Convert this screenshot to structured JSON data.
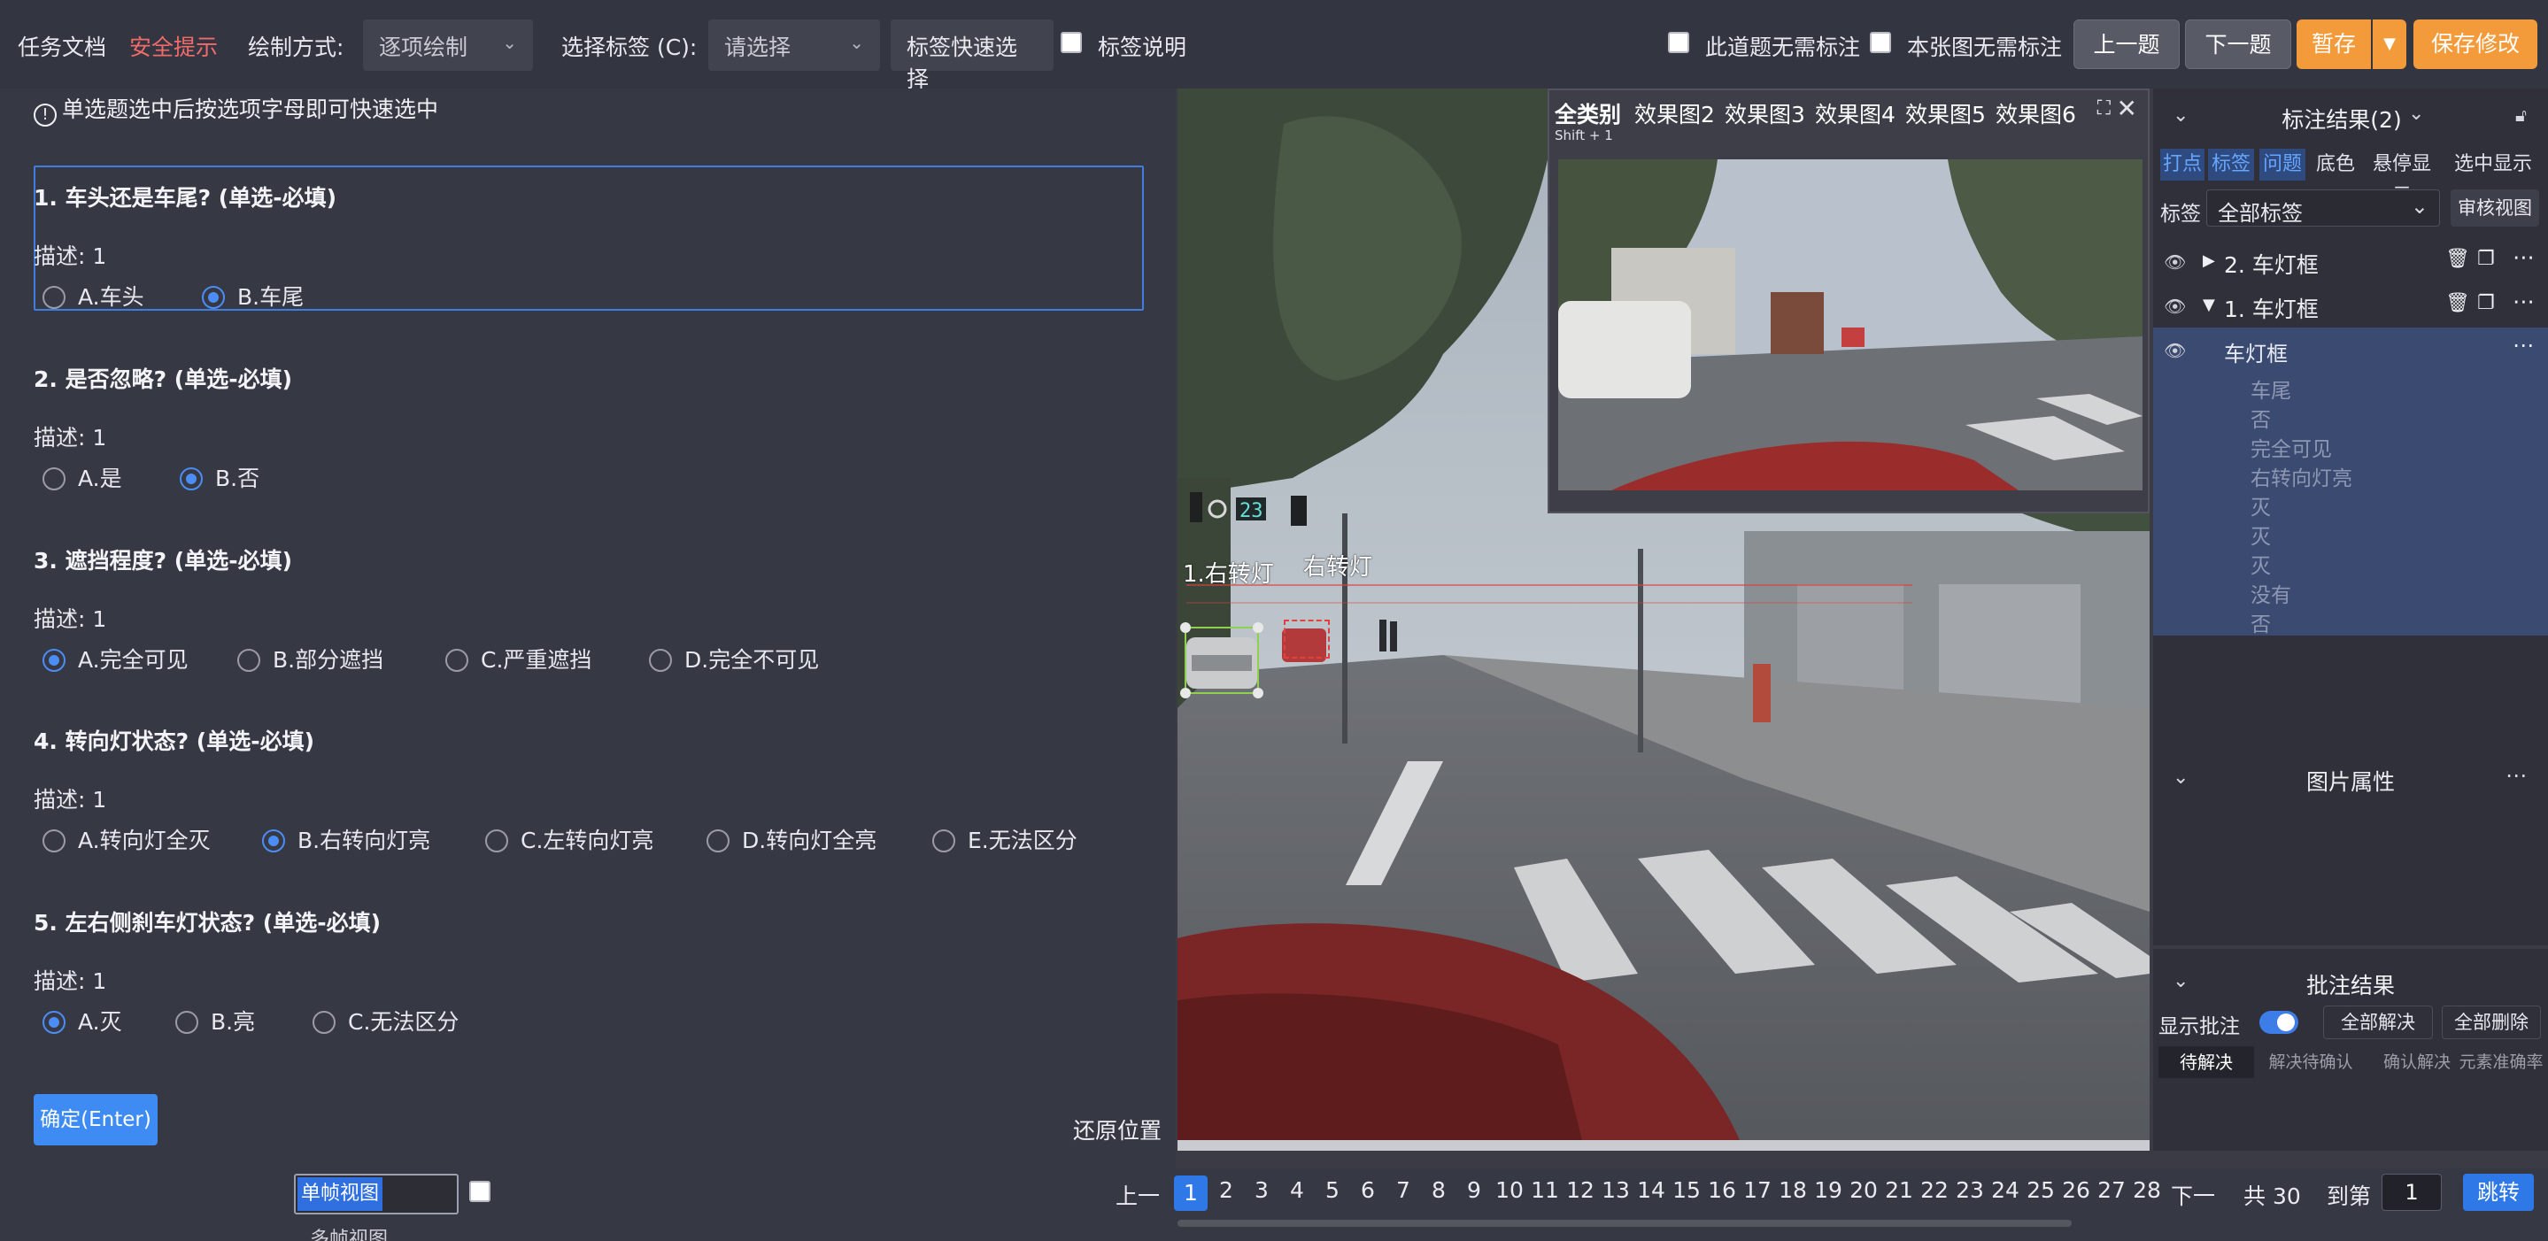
{
  "topbar": {
    "task_doc": "任务文档",
    "safety_tip": "安全提示",
    "draw_mode_label": "绘制方式:",
    "draw_mode_value": "逐项绘制",
    "select_label_label": "选择标签 (C):",
    "select_label_placeholder": "请选择",
    "quick_select": "标签快速选择",
    "label_desc": "标签说明",
    "no_label_question": "此道题无需标注",
    "no_label_image": "本张图无需标注",
    "prev_question": "上一题",
    "next_question": "下一题",
    "temp_save": "暂存",
    "save_edit": "保存修改"
  },
  "panel": {
    "hint": "单选题选中后按选项字母即可快速选中",
    "questions": [
      {
        "title": "1. 车头还是车尾? (单选-必填)",
        "desc": "描述: 1",
        "options": [
          "A.车头",
          "B.车尾"
        ],
        "selected": 1
      },
      {
        "title": "2. 是否忽略? (单选-必填)",
        "desc": "描述: 1",
        "options": [
          "A.是",
          "B.否"
        ],
        "selected": 1
      },
      {
        "title": "3. 遮挡程度? (单选-必填)",
        "desc": "描述: 1",
        "options": [
          "A.完全可见",
          "B.部分遮挡",
          "C.严重遮挡",
          "D.完全不可见"
        ],
        "selected": 0
      },
      {
        "title": "4. 转向灯状态? (单选-必填)",
        "desc": "描述: 1",
        "options": [
          "A.转向灯全灭",
          "B.右转向灯亮",
          "C.左转向灯亮",
          "D.转向灯全亮",
          "E.无法区分"
        ],
        "selected": 1
      },
      {
        "title": "5. 左右侧刹车灯状态? (单选-必填)",
        "desc": "描述: 1",
        "options": [
          "A.灭",
          "B.亮",
          "C.无法区分"
        ],
        "selected": 0
      }
    ],
    "confirm": "确定(Enter)",
    "restore": "还原位置"
  },
  "image": {
    "overlay_label_1": "1.右转灯",
    "overlay_label_2": "右转灯",
    "sign_text": "23"
  },
  "preview": {
    "tabs": [
      "全类别",
      "效果图2",
      "效果图3",
      "效果图4",
      "效果图5",
      "效果图6"
    ],
    "shortcut": "Shift + 1"
  },
  "sidebar": {
    "results_title": "标注结果(2)",
    "filter_buttons": [
      "打点",
      "标签",
      "问题",
      "底色",
      "悬停显示",
      "选中显示"
    ],
    "label_label": "标签",
    "label_select": "全部标签",
    "review_view": "审核视图",
    "items": [
      "2. 车灯框",
      "1. 车灯框"
    ],
    "selected_item": "车灯框",
    "attributes": [
      "车尾",
      "否",
      "完全可见",
      "右转向灯亮",
      "灭",
      "灭",
      "灭",
      "没有",
      "否"
    ],
    "image_props_title": "图片属性",
    "comments_title": "批注结果",
    "show_comments": "显示批注",
    "resolve_all": "全部解决",
    "delete_all": "全部删除",
    "comment_tabs": [
      "待解决",
      "解决待确认",
      "确认解决",
      "元素准确率"
    ]
  },
  "bottom": {
    "single_frame": "单帧视图",
    "multi_frame": "多帧视图",
    "prev": "上一",
    "pages": [
      "1",
      "2",
      "3",
      "4",
      "5",
      "6",
      "7",
      "8",
      "9",
      "10",
      "11",
      "12",
      "13",
      "14",
      "15",
      "16",
      "17",
      "18",
      "19",
      "20",
      "21",
      "22",
      "23",
      "24",
      "25",
      "26",
      "27",
      "28"
    ],
    "current_page": "1",
    "next": "下一",
    "total": "共 30",
    "goto_label": "到第",
    "goto_value": "1",
    "jump": "跳转"
  },
  "colors": {
    "accent": "#3d8bf3",
    "orange": "#f39a3a",
    "danger_text": "#f26b6b",
    "box_green": "#8fd14f"
  }
}
